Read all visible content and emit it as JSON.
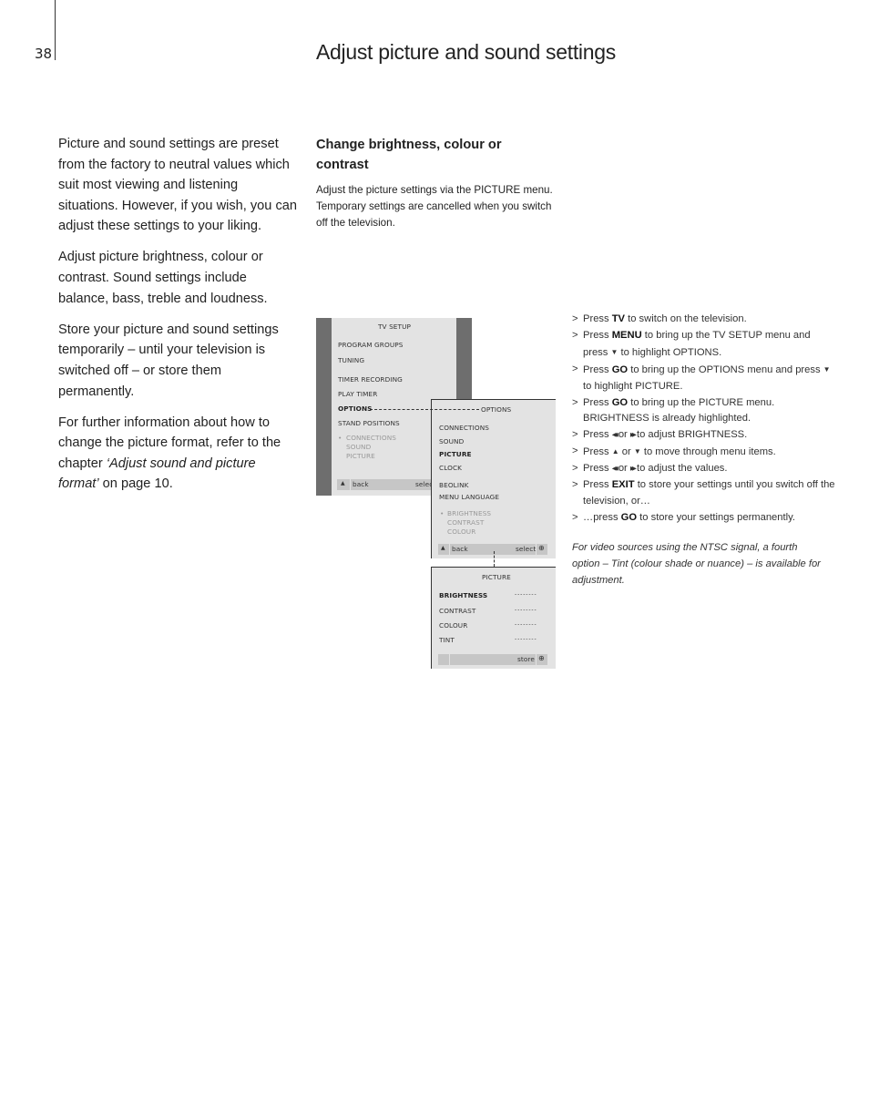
{
  "page_number": "38",
  "title": "Adjust picture and sound settings",
  "intro": {
    "p1": "Picture and sound settings are preset from the factory to neutral values which suit most viewing and listening situations. However, if you wish, you can adjust these settings to your liking.",
    "p2": "Adjust picture brightness, colour or contrast. Sound settings include balance, bass, treble and loudness.",
    "p3": "Store your picture and sound settings temporarily – until your television is switched off – or store them permanently.",
    "p4_pre": "For further information about how to change the picture format, refer to the chapter ",
    "p4_italic": "‘Adjust sound and picture format’",
    "p4_post": " on page 10."
  },
  "section": {
    "heading": "Change brightness, colour or contrast",
    "description": "Adjust the picture settings via the PICTURE menu. Temporary settings are cancelled when you switch off the television."
  },
  "menus": {
    "tv_setup": {
      "title": "TV  SETUP",
      "items": [
        "PROGRAM  GROUPS",
        "TUNING",
        "TIMER  RECORDING",
        "PLAY  TIMER",
        "OPTIONS",
        "STAND POSITIONS"
      ],
      "sub_bullet": "•",
      "sub_items": [
        "CONNECTIONS",
        "SOUND",
        "PICTURE"
      ],
      "back": "back",
      "select": "select"
    },
    "options": {
      "title": "OPTIONS",
      "items": [
        "CONNECTIONS",
        "SOUND",
        "PICTURE",
        "CLOCK",
        "BEOLINK",
        "MENU  LANGUAGE"
      ],
      "sub_bullet": "•",
      "sub_items": [
        "BRIGHTNESS",
        "CONTRAST",
        "COLOUR"
      ],
      "back": "back",
      "select": "select"
    },
    "picture": {
      "title": "PICTURE",
      "items": [
        "BRIGHTNESS",
        "CONTRAST",
        "COLOUR",
        "TINT"
      ],
      "value_placeholder": "- - - - - - - -",
      "store": "store"
    }
  },
  "steps": [
    [
      {
        "t": "Press "
      },
      {
        "k": "TV"
      },
      {
        "t": " to switch on the television."
      }
    ],
    [
      {
        "t": "Press "
      },
      {
        "k": "MENU"
      },
      {
        "t": " to bring up the TV SETUP menu and press "
      },
      {
        "i": "down"
      },
      {
        "t": " to highlight OPTIONS."
      }
    ],
    [
      {
        "t": "Press "
      },
      {
        "k": "GO"
      },
      {
        "t": " to bring up the OPTIONS menu and press "
      },
      {
        "i": "down"
      },
      {
        "t": " to highlight PICTURE."
      }
    ],
    [
      {
        "t": "Press "
      },
      {
        "k": "GO"
      },
      {
        "t": " to bring up the PICTURE menu. BRIGHTNESS is already highlighted."
      }
    ],
    [
      {
        "t": "Press "
      },
      {
        "i": "rewind"
      },
      {
        "t": " or "
      },
      {
        "i": "forward"
      },
      {
        "t": " to adjust BRIGHTNESS."
      }
    ],
    [
      {
        "t": "Press "
      },
      {
        "i": "up"
      },
      {
        "t": " or "
      },
      {
        "i": "down"
      },
      {
        "t": " to move through menu items."
      }
    ],
    [
      {
        "t": "Press "
      },
      {
        "i": "rewind"
      },
      {
        "t": " or "
      },
      {
        "i": "forward"
      },
      {
        "t": " to adjust the values."
      }
    ],
    [
      {
        "t": "Press "
      },
      {
        "k": "EXIT"
      },
      {
        "t": " to store your settings until you switch off the television, or…"
      }
    ],
    [
      {
        "t": "…press "
      },
      {
        "k": "GO"
      },
      {
        "t": " to store your settings permanently."
      }
    ]
  ],
  "step_marker": ">",
  "note": "For video sources using the NTSC signal, a fourth option – Tint (colour shade or nuance) – is available for adjustment.",
  "colors": {
    "menu_frame": "#6e6e6e",
    "menu_bg": "#e3e3e3",
    "menu_bar": "#c6c6c6"
  }
}
